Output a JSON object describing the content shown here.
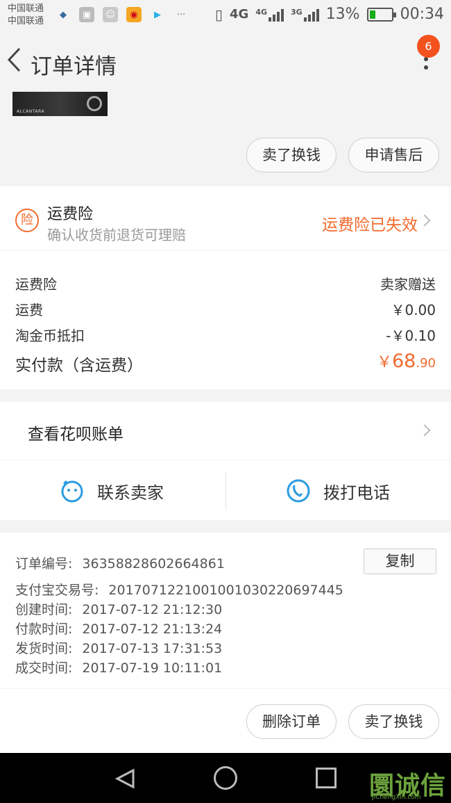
{
  "status_bar": {
    "carrier_1": "中国联通",
    "carrier_2": "中国联通",
    "network_1": "4G",
    "network_2": "4G",
    "network_3": "3G",
    "battery": "13%",
    "time": "00:34",
    "more": "···"
  },
  "header": {
    "title": "订单详情",
    "badge_count": "6"
  },
  "top_actions": {
    "sell_exchange": "卖了换钱",
    "after_sale": "申请售后"
  },
  "insurance": {
    "icon_char": "险",
    "title": "运费险",
    "subtitle": "确认收货前退货可理赔",
    "status": "运费险已失效"
  },
  "fees": [
    {
      "label": "运费险",
      "value": "卖家赠送"
    },
    {
      "label": "运费",
      "value": "￥0.00"
    },
    {
      "label": "淘金币抵扣",
      "value": "-￥0.10"
    }
  ],
  "total": {
    "label": "实付款（含运费）",
    "currency": "￥",
    "integer": "68",
    "decimal": ".90"
  },
  "huabei": {
    "label": "查看花呗账单"
  },
  "contact": {
    "seller": "联系卖家",
    "phone": "拨打电话"
  },
  "order_info": {
    "order_no_label": "订单编号:",
    "order_no": "36358828602664861",
    "copy": "复制",
    "alipay_label": "支付宝交易号:",
    "alipay_no": "2017071221001001030220697445",
    "created_label": "创建时间:",
    "created": "2017-07-12 21:12:30",
    "paid_label": "付款时间:",
    "paid": "2017-07-12 21:13:24",
    "shipped_label": "发货时间:",
    "shipped": "2017-07-13 17:31:53",
    "closed_label": "成交时间:",
    "closed": "2017-07-19 10:11:01"
  },
  "bottom_actions": {
    "delete": "删除订单",
    "sell_exchange": "卖了换钱"
  },
  "watermark": {
    "text": "圜诚信",
    "sub": "JiChengXin.com"
  },
  "colors": {
    "accent": "#f26a2e",
    "link_blue": "#2b9be0"
  }
}
